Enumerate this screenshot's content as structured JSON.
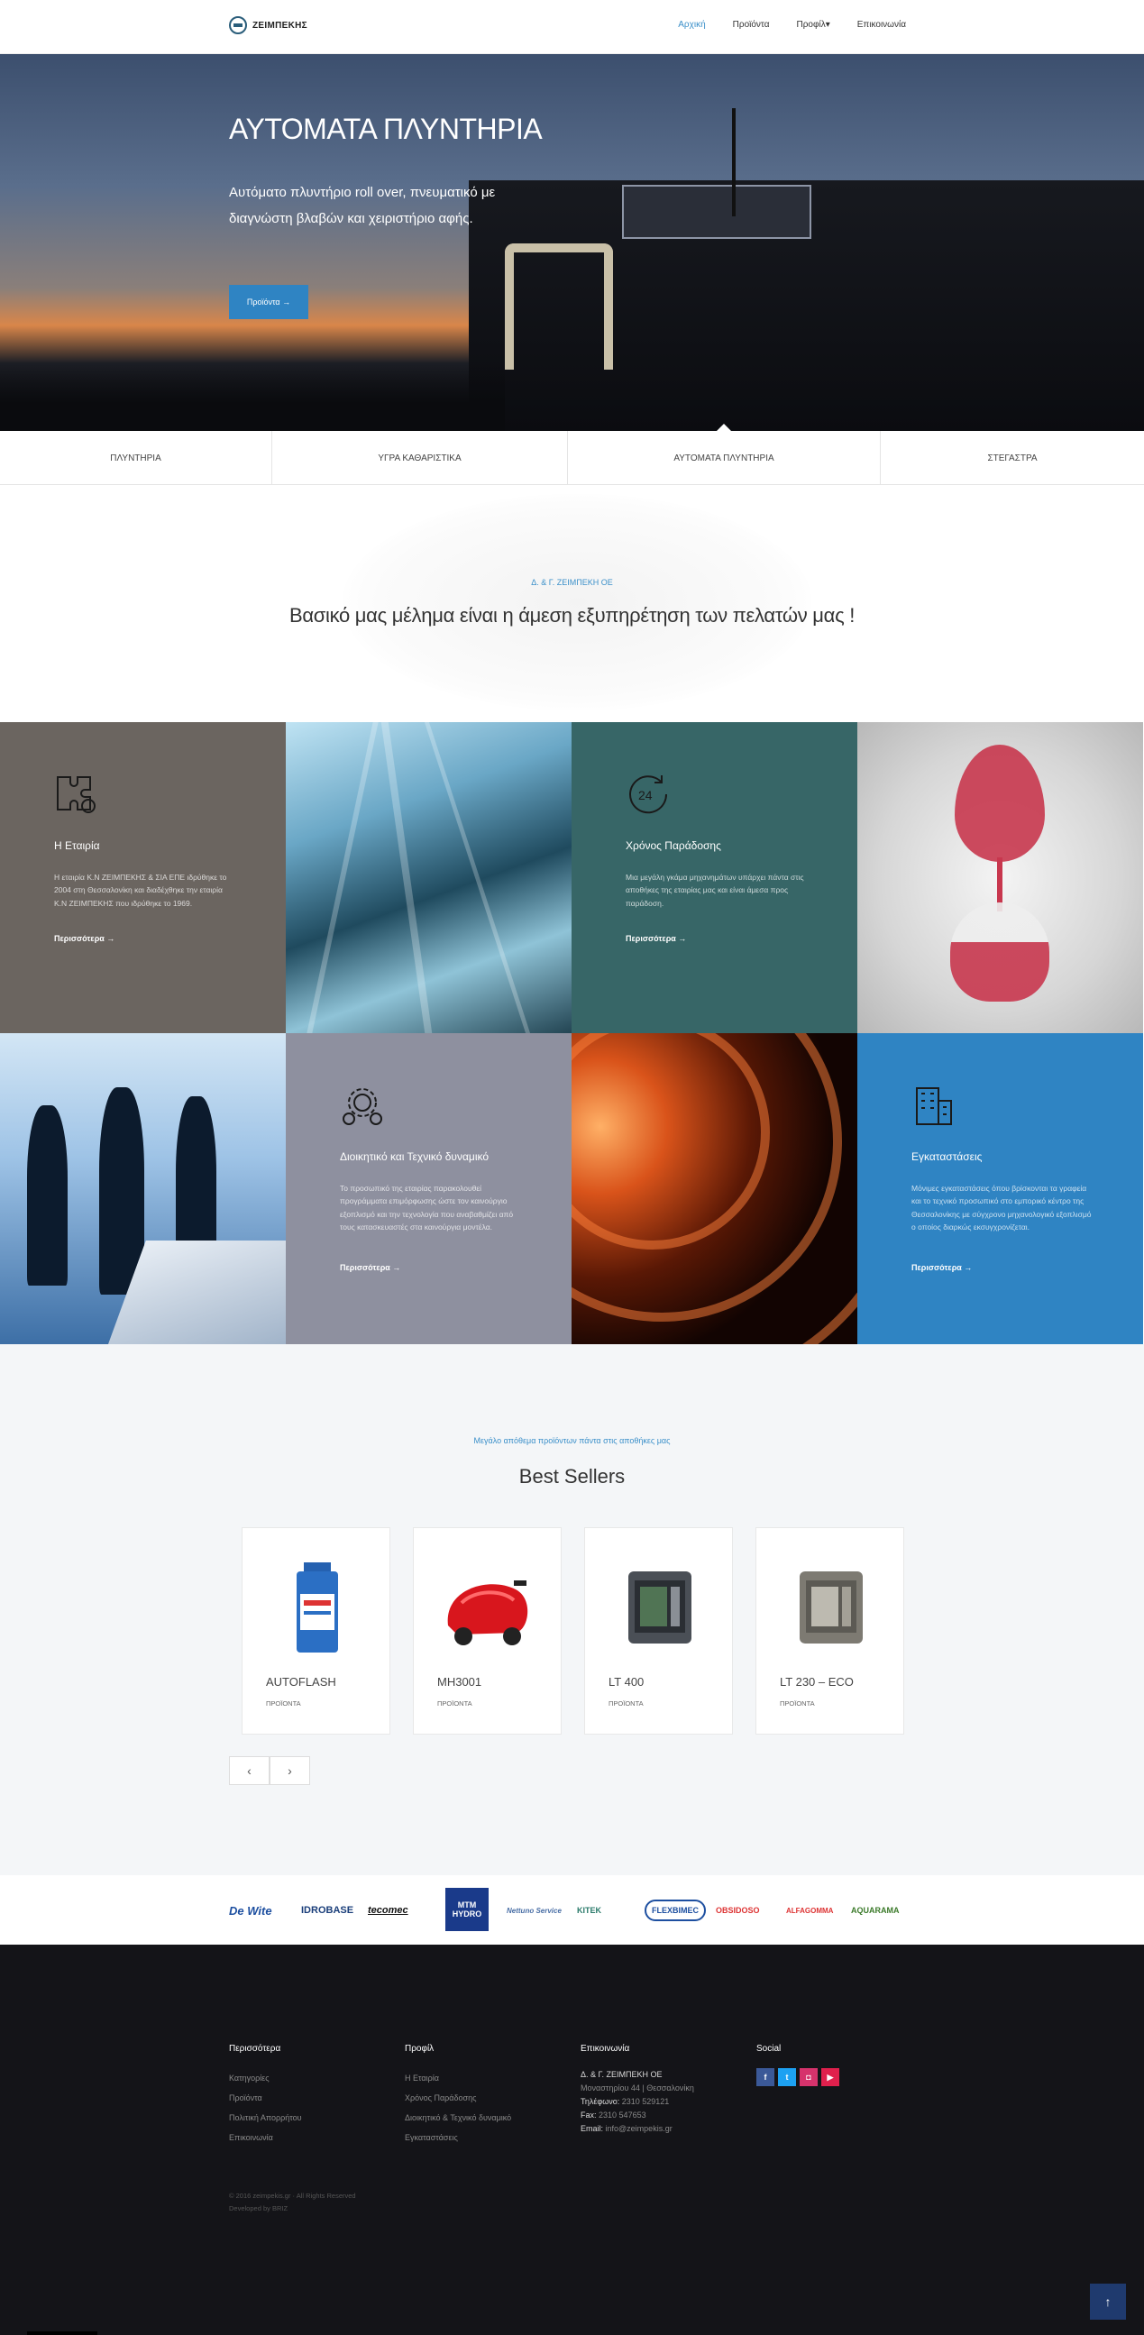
{
  "header": {
    "logo_text": "ΖΕΙΜΠΕΚΗΣ",
    "nav": [
      "Αρχική",
      "Προϊόντα",
      "Προφίλ",
      "Επικοινωνία"
    ]
  },
  "hero": {
    "title": "ΑΥΤΟΜΑΤΑ ΠΛΥΝΤΗΡΙΑ",
    "subtitle": "Αυτόματο πλυντήριο roll over, πνευματικό με διαγνώστη βλαβών και χειριστήριο αφής.",
    "button": "Προϊόντα →"
  },
  "tabs": [
    "ΠΛΥΝΤΗΡΙΑ",
    "ΥΓΡΑ ΚΑΘΑΡΙΣΤΙΚΑ",
    "ΑΥΤΟΜΑΤΑ ΠΛΥΝΤΗΡΙΑ",
    "ΣΤΕΓΑΣΤΡΑ"
  ],
  "intro": {
    "label": "Δ. & Γ. ΖΕΙΜΠΕΚΗ ΟΕ",
    "title": "Βασικό μας μέλημα είναι η άμεση εξυπηρέτηση των πελατών μας !"
  },
  "features": [
    {
      "title": "Η Εταιρία",
      "text": "Η εταιρία Κ.Ν ΖΕΙΜΠΕΚΗΣ & ΣΙΑ ΕΠΕ ιδρύθηκε το 2004 στη Θεσσαλονίκη και διαδέχθηκε την εταιρία Κ.Ν ΖΕΙΜΠΕΚΗΣ που ιδρύθηκε το 1969.",
      "more": "Περισσότερα →",
      "color": "#6b6560",
      "icon": "puzzle-icon"
    },
    {
      "title": "Χρόνος Παράδοσης",
      "text": "Μια μεγάλη γκάμα μηχανημάτων υπάρχει πάντα στις αποθήκες της εταιρίας μας και είναι άμεσα προς παράδοση.",
      "more": "Περισσότερα →",
      "color": "#376667",
      "icon": "clock-24-icon"
    },
    {
      "title": "Διοικητικό και Τεχνικό δυναμικό",
      "text": "Το προσωπικό της εταιρίας παρακολουθεί προγράμματα επιμόρφωσης ώστε τον καινούργιο εξοπλισμό και την τεχνολογία που αναβαθμίζει από τους κατασκευαστές στα καινούργια μοντέλα.",
      "more": "Περισσότερα →",
      "color": "#8e909f",
      "icon": "gears-icon"
    },
    {
      "title": "Εγκαταστάσεις",
      "text": "Μόνιμες εγκαταστάσεις όπου βρίσκονται τα γραφεία και το τεχνικό προσωπικό στο εμπορικό κέντρο της Θεσσαλονίκης με σύγχρονο μηχανολογικό εξοπλισμό ο οποίος διαρκώς εκσυγχρονίζεται.",
      "more": "Περισσότερα →",
      "color": "#2f84c3",
      "icon": "building-icon"
    }
  ],
  "best_sellers": {
    "label": "Μεγάλο απόθεμα προϊόντων πάντα στις αποθήκες μας",
    "title": "Best Sellers",
    "products": [
      {
        "name": "AUTOFLASH",
        "category": "ΠΡΟΪΟΝΤΑ"
      },
      {
        "name": "MH3001",
        "category": "ΠΡΟΪΟΝΤΑ"
      },
      {
        "name": "LT 400",
        "category": "ΠΡΟΪΟΝΤΑ"
      },
      {
        "name": "LT 230 – ECO",
        "category": "ΠΡΟΪΟΝΤΑ"
      }
    ],
    "prev": "‹",
    "next": "›"
  },
  "brands": [
    "De Wite",
    "IDROBASE",
    "tecomec",
    "MTM HYDRO",
    "Nettuno Service",
    "KITEK",
    "FLEXBIMEC",
    "OBSIDOSO",
    "ALFAGOMMA",
    "AQUARAMA"
  ],
  "footer": {
    "col1_title": "Περισσότερα",
    "col1_links": [
      "Κατηγορίες",
      "Προϊόντα",
      "Πολιτική Απορρήτου",
      "Επικοινωνία"
    ],
    "col2_title": "Προφίλ",
    "col2_links": [
      "Η Εταιρία",
      "Χρόνος Παράδοσης",
      "Διοικητικό & Τεχνικό δυναμικό",
      "Εγκαταστάσεις"
    ],
    "col3_title": "Επικοινωνία",
    "company": "Δ. & Γ. ΖΕΙΜΠΕΚΗ ΟΕ",
    "address": "Μοναστηρίου 44 | Θεσσαλονίκη",
    "phone_label": "Τηλέφωνο:",
    "phone": "2310 529121",
    "fax_label": "Fax:",
    "fax": "2310 547653",
    "email_label": "Email:",
    "email": "info@zeimpekis.gr",
    "col4_title": "Social",
    "copyright": "© 2016 zeimpekis.gr · All Rights Reserved",
    "developed": "Developed by BRIZ"
  },
  "to_top": "↑"
}
